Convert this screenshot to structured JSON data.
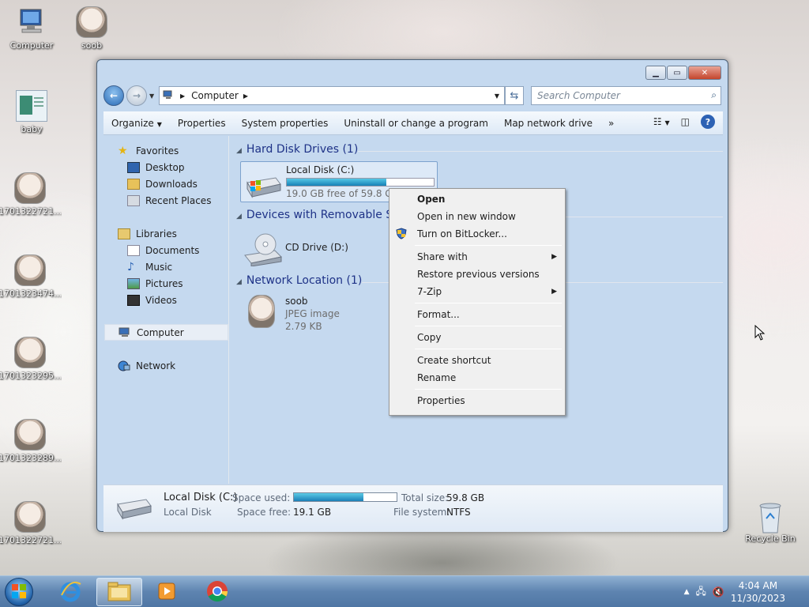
{
  "desktop": {
    "icons": [
      {
        "label": "Computer"
      },
      {
        "label": "soob"
      },
      {
        "label": "baby"
      },
      {
        "label": "1701322721..."
      },
      {
        "label": "1701323474..."
      },
      {
        "label": "1701323295..."
      },
      {
        "label": "1701323289..."
      },
      {
        "label": "1701322721..."
      },
      {
        "label": "Recycle Bin"
      }
    ]
  },
  "window": {
    "address": {
      "location": "Computer"
    },
    "search": {
      "placeholder": "Search Computer"
    },
    "toolbar": {
      "organize": "Organize",
      "properties": "Properties",
      "system_properties": "System properties",
      "uninstall": "Uninstall or change a program",
      "map_drive": "Map network drive",
      "more": "»"
    },
    "nav": {
      "favorites": "Favorites",
      "desktop": "Desktop",
      "downloads": "Downloads",
      "recent": "Recent Places",
      "libraries": "Libraries",
      "documents": "Documents",
      "music": "Music",
      "pictures": "Pictures",
      "videos": "Videos",
      "computer": "Computer",
      "network": "Network"
    },
    "groups": {
      "hard_disk": "Hard Disk Drives (1)",
      "removable": "Devices with Removable Storage (1)",
      "network_location": "Network Location (1)"
    },
    "items": {
      "local_disk": {
        "name": "Local Disk (C:)",
        "free": "19.0 GB free of 59.8 GB",
        "used_fraction": 0.68
      },
      "cd_drive": {
        "name": "CD Drive (D:)"
      },
      "soob": {
        "name": "soob",
        "type": "JPEG image",
        "size": "2.79 KB"
      }
    },
    "details": {
      "name": "Local Disk (C:)",
      "type": "Local Disk",
      "space_used_label": "Space used:",
      "space_used_fraction": 0.68,
      "space_free_label": "Space free:",
      "space_free": "19.1 GB",
      "total_size_label": "Total size:",
      "total_size": "59.8 GB",
      "file_system_label": "File system:",
      "file_system": "NTFS"
    }
  },
  "context_menu": {
    "open": "Open",
    "open_new_window": "Open in new window",
    "bitlocker": "Turn on BitLocker...",
    "share_with": "Share with",
    "restore": "Restore previous versions",
    "zip": "7-Zip",
    "format": "Format...",
    "copy": "Copy",
    "create_shortcut": "Create shortcut",
    "rename": "Rename",
    "properties": "Properties"
  },
  "taskbar": {
    "time": "4:04 AM",
    "date": "11/30/2023"
  }
}
